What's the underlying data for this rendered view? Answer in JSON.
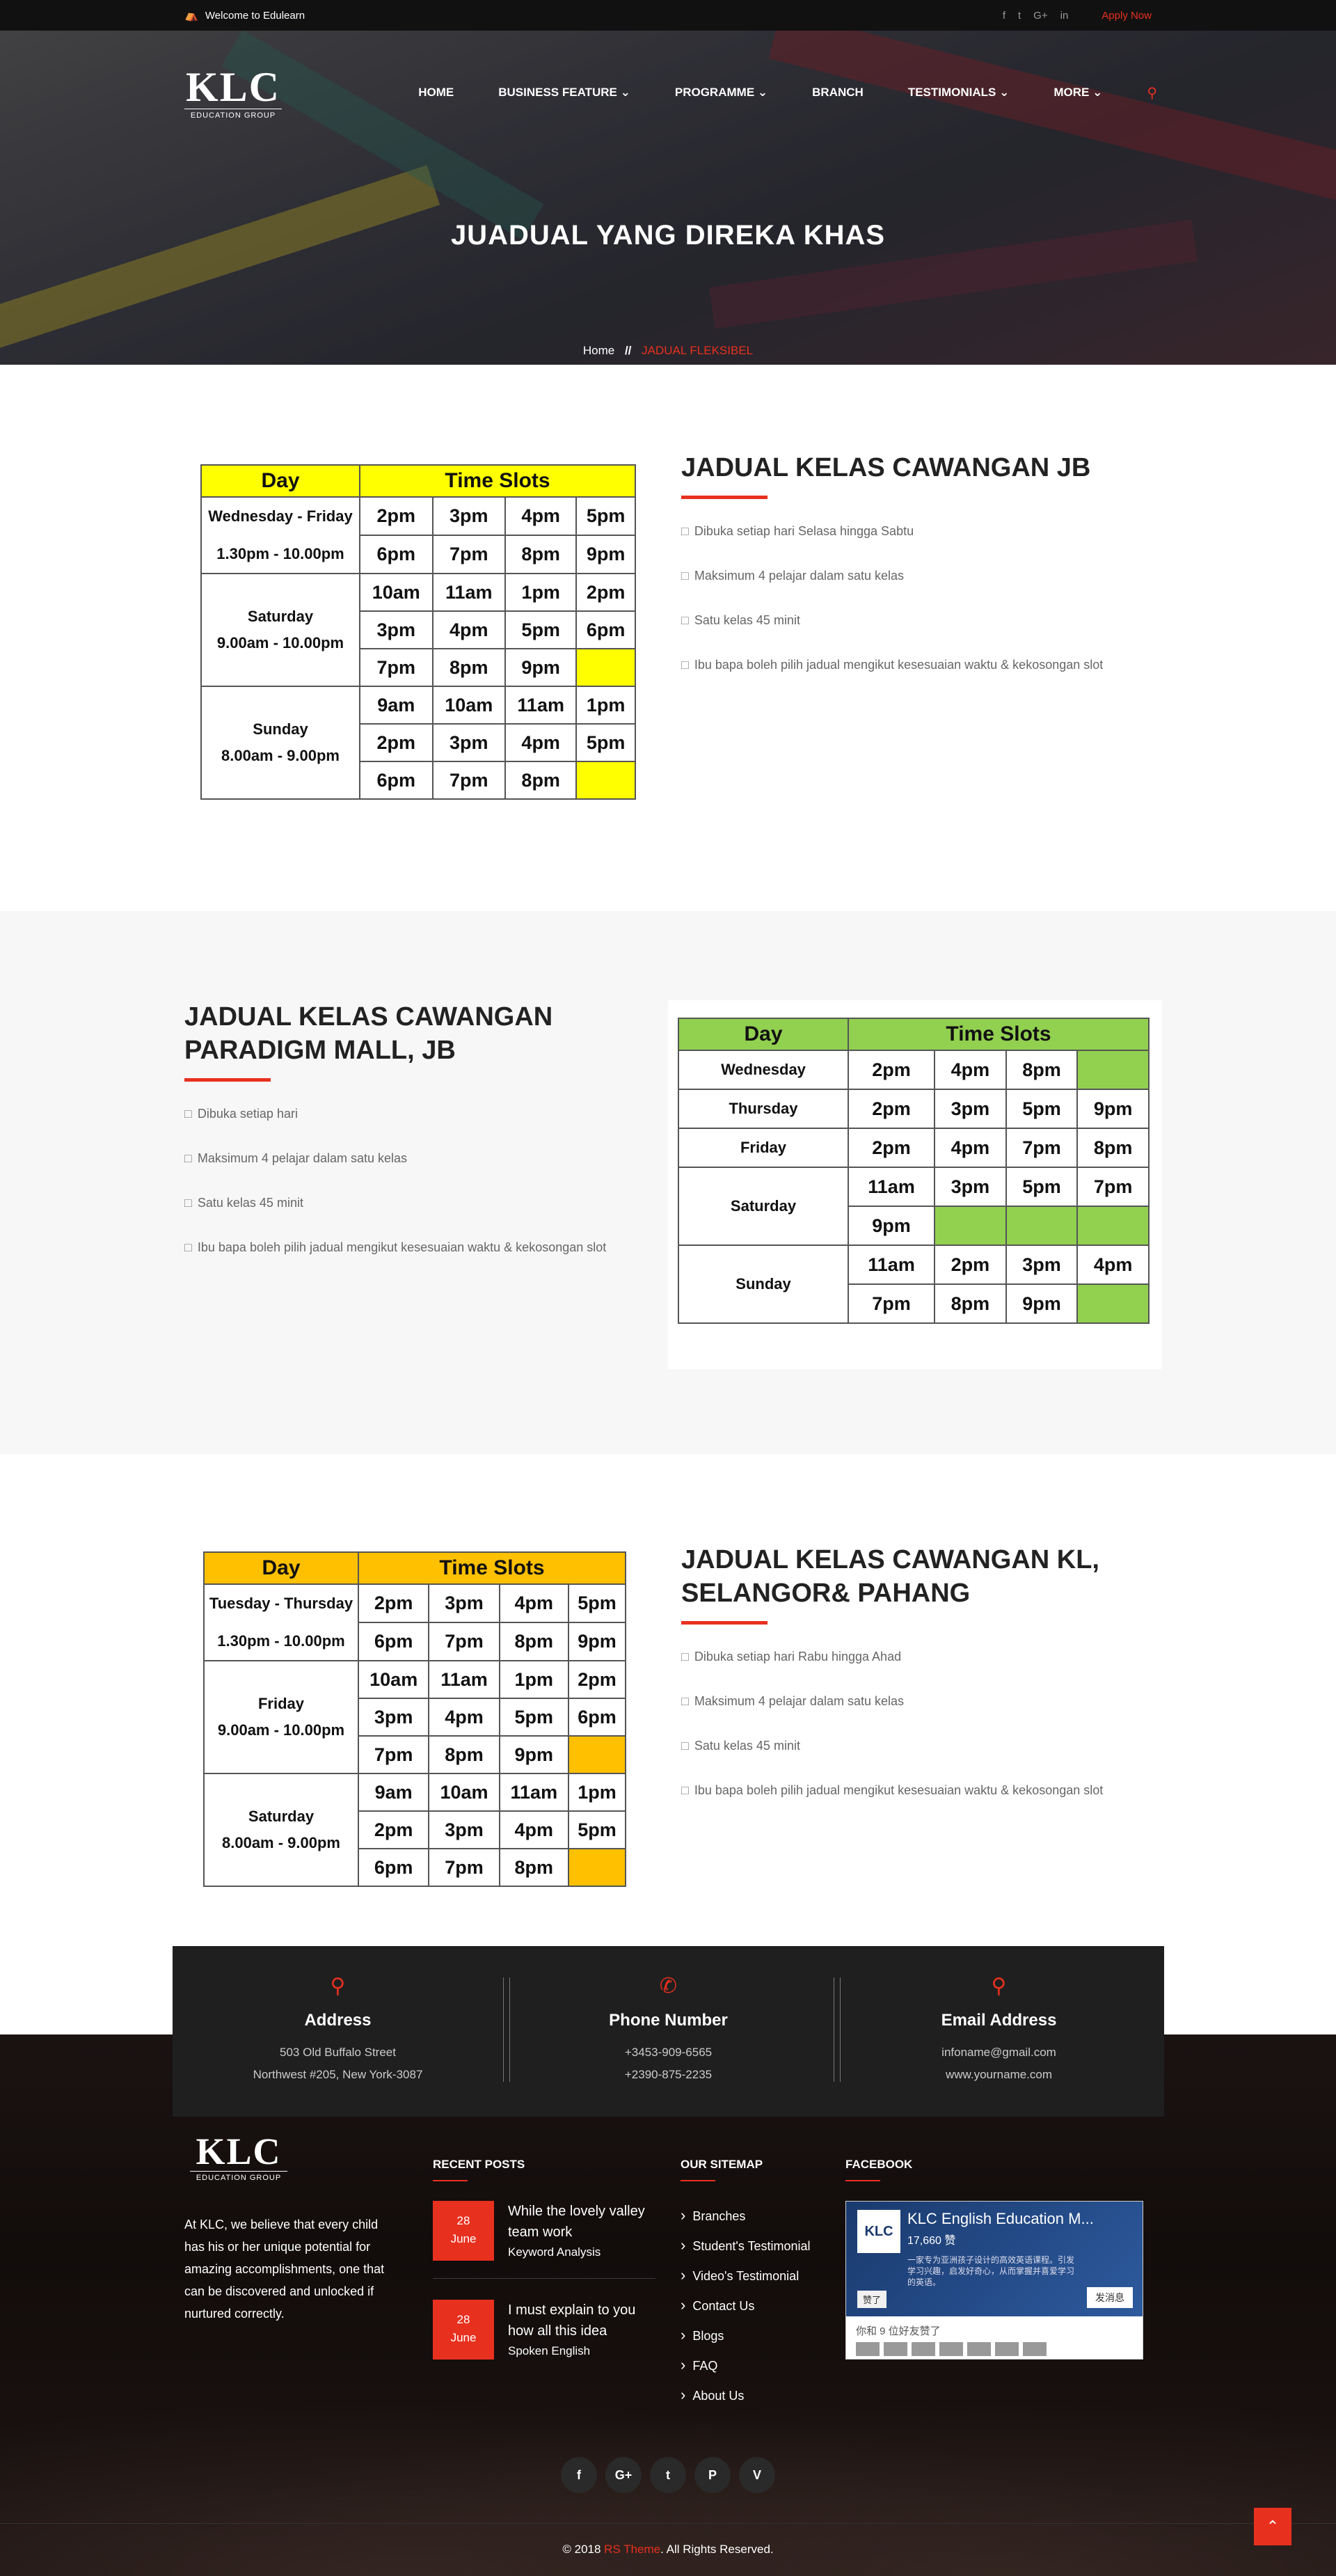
{
  "topbar": {
    "welcome": "Welcome to Edulearn",
    "social": [
      "f",
      "t",
      "G+",
      "in"
    ],
    "apply": "Apply Now"
  },
  "logo": {
    "big": "KLC",
    "small": "EDUCATION GROUP"
  },
  "nav": {
    "items": [
      "HOME",
      "BUSINESS FEATURE",
      "PROGRAMME",
      "BRANCH",
      "TESTIMONIALS",
      "MORE"
    ],
    "dropdown_flags": [
      false,
      true,
      true,
      false,
      true,
      true
    ]
  },
  "hero": {
    "title": "JUADUAL YANG DIREKA KHAS",
    "breadcrumb_home": "Home",
    "breadcrumb_sep": "//",
    "breadcrumb_current": "JADUAL FLEKSIBEL"
  },
  "colors": {
    "accent": "#e8301f",
    "table1": "#ffff00",
    "table2": "#92d050",
    "table3": "#ffc000"
  },
  "section1": {
    "title": "JADUAL KELAS CAWANGAN JB",
    "points": [
      "Dibuka setiap hari Selasa hingga Sabtu",
      "Maksimum 4 pelajar dalam satu kelas",
      "Satu kelas 45 minit",
      "Ibu bapa boleh pilih jadual mengikut kesesuaian waktu & kekosongan slot"
    ],
    "table": {
      "head_day": "Day",
      "head_slots": "Time Slots",
      "groups": [
        {
          "day": "Wednesday - Friday",
          "time": "1.30pm - 10.00pm",
          "rows": [
            [
              "2pm",
              "3pm",
              "4pm",
              "5pm"
            ],
            [
              "6pm",
              "7pm",
              "8pm",
              "9pm"
            ]
          ]
        },
        {
          "day": "Saturday",
          "time": "9.00am - 10.00pm",
          "rows": [
            [
              "10am",
              "11am",
              "1pm",
              "2pm"
            ],
            [
              "3pm",
              "4pm",
              "5pm",
              "6pm"
            ],
            [
              "7pm",
              "8pm",
              "9pm",
              ""
            ]
          ]
        },
        {
          "day": "Sunday",
          "time": "8.00am - 9.00pm",
          "rows": [
            [
              "9am",
              "10am",
              "11am",
              "1pm"
            ],
            [
              "2pm",
              "3pm",
              "4pm",
              "5pm"
            ],
            [
              "6pm",
              "7pm",
              "8pm",
              ""
            ]
          ]
        }
      ]
    }
  },
  "section2": {
    "title": "JADUAL KELAS CAWANGAN PARADIGM MALL, JB",
    "points": [
      "Dibuka setiap hari",
      "Maksimum 4 pelajar dalam satu kelas",
      "Satu kelas 45 minit",
      "Ibu bapa boleh pilih jadual mengikut kesesuaian waktu & kekosongan slot"
    ],
    "table": {
      "head_day": "Day",
      "head_slots": "Time Slots",
      "groups": [
        {
          "day": "Wednesday",
          "rows": [
            [
              "2pm",
              "4pm",
              "8pm",
              ""
            ]
          ]
        },
        {
          "day": "Thursday",
          "rows": [
            [
              "2pm",
              "3pm",
              "5pm",
              "9pm"
            ]
          ]
        },
        {
          "day": "Friday",
          "rows": [
            [
              "2pm",
              "4pm",
              "7pm",
              "8pm"
            ]
          ]
        },
        {
          "day": "Saturday",
          "rows": [
            [
              "11am",
              "3pm",
              "5pm",
              "7pm"
            ],
            [
              "9pm",
              "",
              "",
              ""
            ]
          ]
        },
        {
          "day": "Sunday",
          "rows": [
            [
              "11am",
              "2pm",
              "3pm",
              "4pm"
            ],
            [
              "7pm",
              "8pm",
              "9pm",
              ""
            ]
          ]
        }
      ]
    }
  },
  "section3": {
    "title": "JADUAL KELAS CAWANGAN KL, SELANGOR& PAHANG",
    "points": [
      "Dibuka setiap hari Rabu hingga Ahad",
      "Maksimum 4 pelajar dalam satu kelas",
      "Satu kelas 45 minit",
      "Ibu bapa boleh pilih jadual mengikut kesesuaian waktu & kekosongan slot"
    ],
    "table": {
      "head_day": "Day",
      "head_slots": "Time Slots",
      "groups": [
        {
          "day": "Tuesday - Thursday",
          "time": "1.30pm - 10.00pm",
          "rows": [
            [
              "2pm",
              "3pm",
              "4pm",
              "5pm"
            ],
            [
              "6pm",
              "7pm",
              "8pm",
              "9pm"
            ]
          ]
        },
        {
          "day": "Friday",
          "time": "9.00am - 10.00pm",
          "rows": [
            [
              "10am",
              "11am",
              "1pm",
              "2pm"
            ],
            [
              "3pm",
              "4pm",
              "5pm",
              "6pm"
            ],
            [
              "7pm",
              "8pm",
              "9pm",
              ""
            ]
          ]
        },
        {
          "day": "Saturday",
          "time": "8.00am - 9.00pm",
          "rows": [
            [
              "9am",
              "10am",
              "11am",
              "1pm"
            ],
            [
              "2pm",
              "3pm",
              "4pm",
              "5pm"
            ],
            [
              "6pm",
              "7pm",
              "8pm",
              ""
            ]
          ]
        }
      ]
    }
  },
  "contact": {
    "address": {
      "title": "Address",
      "line1": "503 Old Buffalo Street",
      "line2": "Northwest #205, New York-3087"
    },
    "phone": {
      "title": "Phone Number",
      "line1": "+3453-909-6565",
      "line2": "+2390-875-2235"
    },
    "email": {
      "title": "Email Address",
      "line1": "infoname@gmail.com",
      "line2": "www.yourname.com"
    }
  },
  "footer": {
    "about": "At KLC, we believe that every child has his or her unique potential for amazing accomplishments, one that can be discovered and unlocked if nurtured correctly.",
    "recent_title": "RECENT POSTS",
    "posts": [
      {
        "day": "28",
        "month": "June",
        "title": "While the lovely valley team work",
        "cat": "Keyword Analysis"
      },
      {
        "day": "28",
        "month": "June",
        "title": "I must explain to you how all this idea",
        "cat": "Spoken English"
      }
    ],
    "sitemap_title": "OUR SITEMAP",
    "sitemap": [
      "Branches",
      "Student's Testimonial",
      "Video's Testimonial",
      "Contact Us",
      "Blogs",
      "FAQ",
      "About Us"
    ],
    "facebook_title": "FACEBOOK",
    "fb": {
      "name": "KLC English Education M...",
      "likes": "17,660 赞",
      "desc": "一家专为亚洲孩子设计的高效英语课程。引发学习兴趣，启发好奇心，从而掌握并喜爱学习的英语。",
      "like_btn": "赞了",
      "msg_btn": "发消息",
      "friends": "你和 9 位好友赞了"
    },
    "social": [
      "f",
      "G+",
      "t",
      "P",
      "V"
    ],
    "copyright_pre": "© 2018 ",
    "copyright_brand": "RS Theme",
    "copyright_post": ". All Rights Reserved."
  }
}
